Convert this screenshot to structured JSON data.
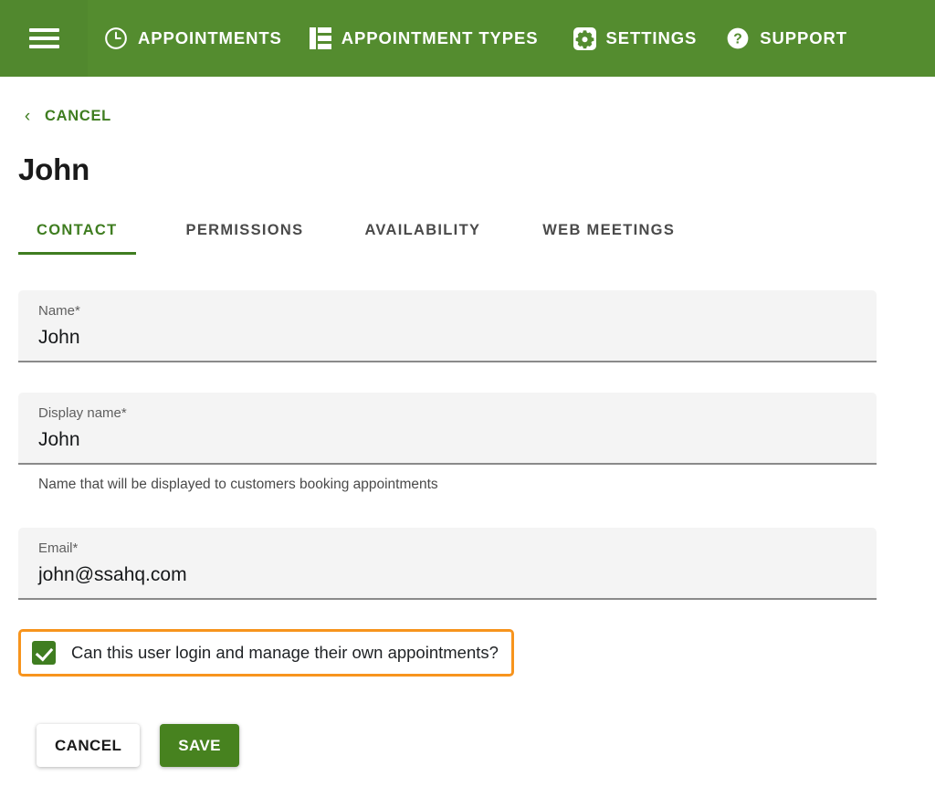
{
  "colors": {
    "brand_green": "#548c2f",
    "brand_green_dark": "#51882e",
    "link_green": "#3f7d20",
    "save_green": "#47821f",
    "highlight_orange": "#f7941d",
    "field_bg": "#f4f4f4",
    "field_underline": "#8a8a8a"
  },
  "appbar": {
    "menu_icon": "hamburger-menu-icon",
    "items": [
      {
        "label": "APPOINTMENTS",
        "icon": "clock-icon"
      },
      {
        "label": "APPOINTMENT TYPES",
        "icon": "list-grid-icon"
      },
      {
        "label": "SETTINGS",
        "icon": "gear-icon"
      },
      {
        "label": "SUPPORT",
        "icon": "question-mark-circle-icon"
      }
    ]
  },
  "back": {
    "chevron": "‹",
    "label": "CANCEL"
  },
  "page": {
    "title": "John"
  },
  "tabs": [
    {
      "label": "CONTACT",
      "active": true
    },
    {
      "label": "PERMISSIONS",
      "active": false
    },
    {
      "label": "AVAILABILITY",
      "active": false
    },
    {
      "label": "WEB MEETINGS",
      "active": false
    }
  ],
  "form": {
    "name": {
      "label": "Name*",
      "value": "John",
      "placeholder": "Name*"
    },
    "display_name": {
      "label": "Display name*",
      "value": "John",
      "placeholder": "Display name*",
      "hint": "Name that will be displayed to customers booking appointments"
    },
    "email": {
      "label": "Email*",
      "value": "john@ssahq.com",
      "placeholder": "Email*"
    },
    "login_checkbox": {
      "label": "Can this user login and manage their own appointments?",
      "checked": true
    }
  },
  "actions": {
    "cancel_label": "CANCEL",
    "save_label": "SAVE"
  }
}
